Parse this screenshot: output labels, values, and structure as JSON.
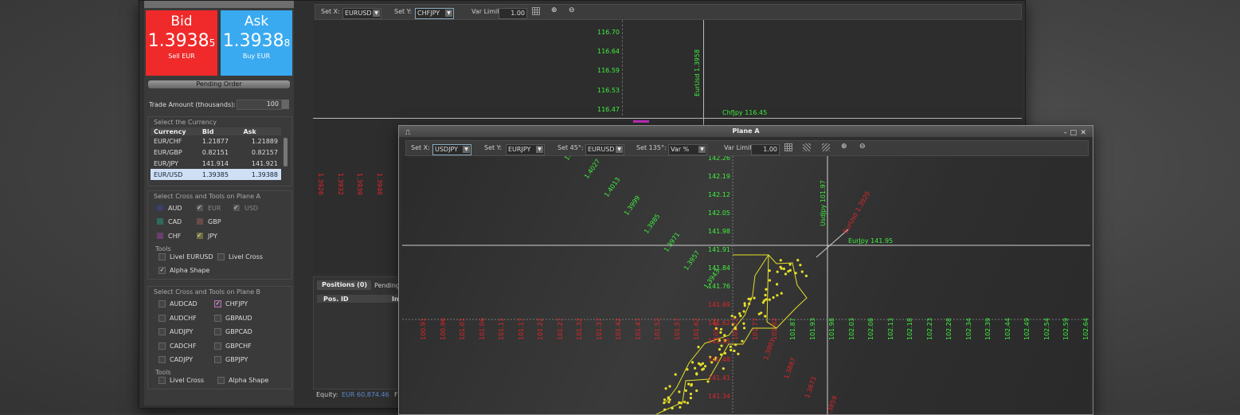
{
  "left_panel": {
    "bid": {
      "label": "Bid",
      "price_main": "1.3938",
      "price_pip": "5",
      "action": "Sell EUR"
    },
    "ask": {
      "label": "Ask",
      "price_main": "1.3938",
      "price_pip": "8",
      "action": "Buy EUR"
    },
    "pending_order_label": "Pending Order",
    "trade_amount_label": "Trade Amount (thousands):",
    "trade_amount_value": "100",
    "select_currency_label": "Select the Currency",
    "currency_table": {
      "headers": [
        "Currency",
        "Bid",
        "Ask"
      ],
      "rows": [
        [
          "EUR/CHF",
          "1.21877",
          "1.21889"
        ],
        [
          "EUR/GBP",
          "0.82151",
          "0.82157"
        ],
        [
          "EUR/JPY",
          "141.914",
          "141.921"
        ],
        [
          "EUR/USD",
          "1.39385",
          "1.39388"
        ]
      ]
    },
    "plane_a_group_label": "Select Cross and Tools on Plane A",
    "plane_a_currencies": [
      {
        "label": "AUD",
        "color": "#3a3f6e",
        "checked": false
      },
      {
        "label": "EUR",
        "color": "#555555",
        "checked": true
      },
      {
        "label": "USD",
        "color": "#555555",
        "checked": true
      },
      {
        "label": "CAD",
        "color": "#2f6a5c",
        "checked": false
      },
      {
        "label": "GBP",
        "color": "#6a4a4a",
        "checked": false
      },
      {
        "label": "CHF",
        "color": "#6a3f6a",
        "checked": false
      },
      {
        "label": "JPY",
        "color": "#6e6e3f",
        "checked": true
      }
    ],
    "tools_label": "Tools",
    "plane_a_tools": [
      {
        "label": "Livel EURUSD",
        "checked": false
      },
      {
        "label": "Livel Cross",
        "checked": false
      },
      {
        "label": "Alpha Shape",
        "checked": true
      }
    ],
    "plane_b_group_label": "Select Cross and Tools on Plane B",
    "plane_b_crosses": [
      {
        "label": "AUDCAD",
        "checked": false
      },
      {
        "label": "CHFJPY",
        "checked": true
      },
      {
        "label": "AUDCHF",
        "checked": false
      },
      {
        "label": "GBPAUD",
        "checked": false
      },
      {
        "label": "AUDJPY",
        "checked": false
      },
      {
        "label": "GBPCAD",
        "checked": false
      },
      {
        "label": "CADCHF",
        "checked": false
      },
      {
        "label": "GBPCHF",
        "checked": false
      },
      {
        "label": "CADJPY",
        "checked": false
      },
      {
        "label": "GBPJPY",
        "checked": false
      }
    ],
    "plane_b_tools": [
      {
        "label": "Livel Cross",
        "checked": false
      },
      {
        "label": "Alpha Shape",
        "checked": false
      }
    ]
  },
  "plane_b": {
    "toolbar": {
      "set_x_label": "Set X:",
      "set_x_value": "EURUSD",
      "set_y_label": "Set Y:",
      "set_y_value": "CHFJPY",
      "var_limit_label": "Var Limit",
      "var_limit_value": "1.00"
    },
    "y_ticks": [
      "116.70",
      "116.64",
      "116.59",
      "116.53",
      "116.47"
    ],
    "x_ticks": [
      "1.3926",
      "1.3932",
      "1.3939",
      "1.3946"
    ],
    "cursor_x_label": "EurUsd  1.3958",
    "cursor_y_label": "ChfJpy  116.45",
    "positions_tab": "Positions (0)",
    "pending_tab": "Pending",
    "pos_id_header": "Pos. ID",
    "pos_second_header": "In",
    "equity_label": "Equity:",
    "equity_value": "EUR  60,874.46",
    "equity_suffix": "F"
  },
  "plane_a": {
    "title": "Plane A",
    "toolbar": {
      "set_x_label": "Set X:",
      "set_x_value": "USDJPY",
      "set_y_label": "Set Y:",
      "set_y_value": "EURJPY",
      "set_45_label": "Set 45°:",
      "set_45_value": "EURUSD",
      "set_135_label": "Set 135°:",
      "set_135_value": "Var %",
      "var_limit_label": "Var Limit",
      "var_limit_value": "1.00"
    },
    "y_ticks": [
      "142.26",
      "142.19",
      "142.12",
      "142.05",
      "141.98",
      "141.91",
      "141.84",
      "141.76",
      "141.69",
      "141.62",
      "141.55",
      "141.48",
      "141.41",
      "141.34"
    ],
    "x_ticks_red": [
      "100.91",
      "100.96",
      "101.01",
      "101.06",
      "101.11",
      "101.17",
      "101.22",
      "101.27",
      "101.32",
      "101.37",
      "101.42",
      "101.47",
      "101.52",
      "101.57",
      "101.62",
      "101.67",
      "101.72",
      "101.77",
      "101.82"
    ],
    "x_ticks_green": [
      "101.87",
      "101.93",
      "101.98",
      "102.03",
      "102.08",
      "102.13",
      "102.18",
      "102.23",
      "102.28",
      "102.34",
      "102.39",
      "102.44",
      "102.49",
      "102.54",
      "102.59",
      "102.64"
    ],
    "diag45_ticks": [
      "1.404",
      "1.4027",
      "1.4013",
      "1.3999",
      "1.3985",
      "1.3971",
      "1.3957",
      "1.3943"
    ],
    "diag45_red_ticks": [
      "1.3901",
      "1.3887",
      "1.3873",
      "1.3859"
    ],
    "cursor_usdjpy": "UsdJpy  101.97",
    "cursor_eurjpy": "EurJpy  141.95",
    "cursor_eurusd": "EurUsd  1.3920"
  },
  "colors": {
    "bid": "#f02a2a",
    "ask": "#3aaaf0",
    "green": "#3ef03e",
    "red": "#e0262a",
    "shape": "#e6e02a"
  }
}
